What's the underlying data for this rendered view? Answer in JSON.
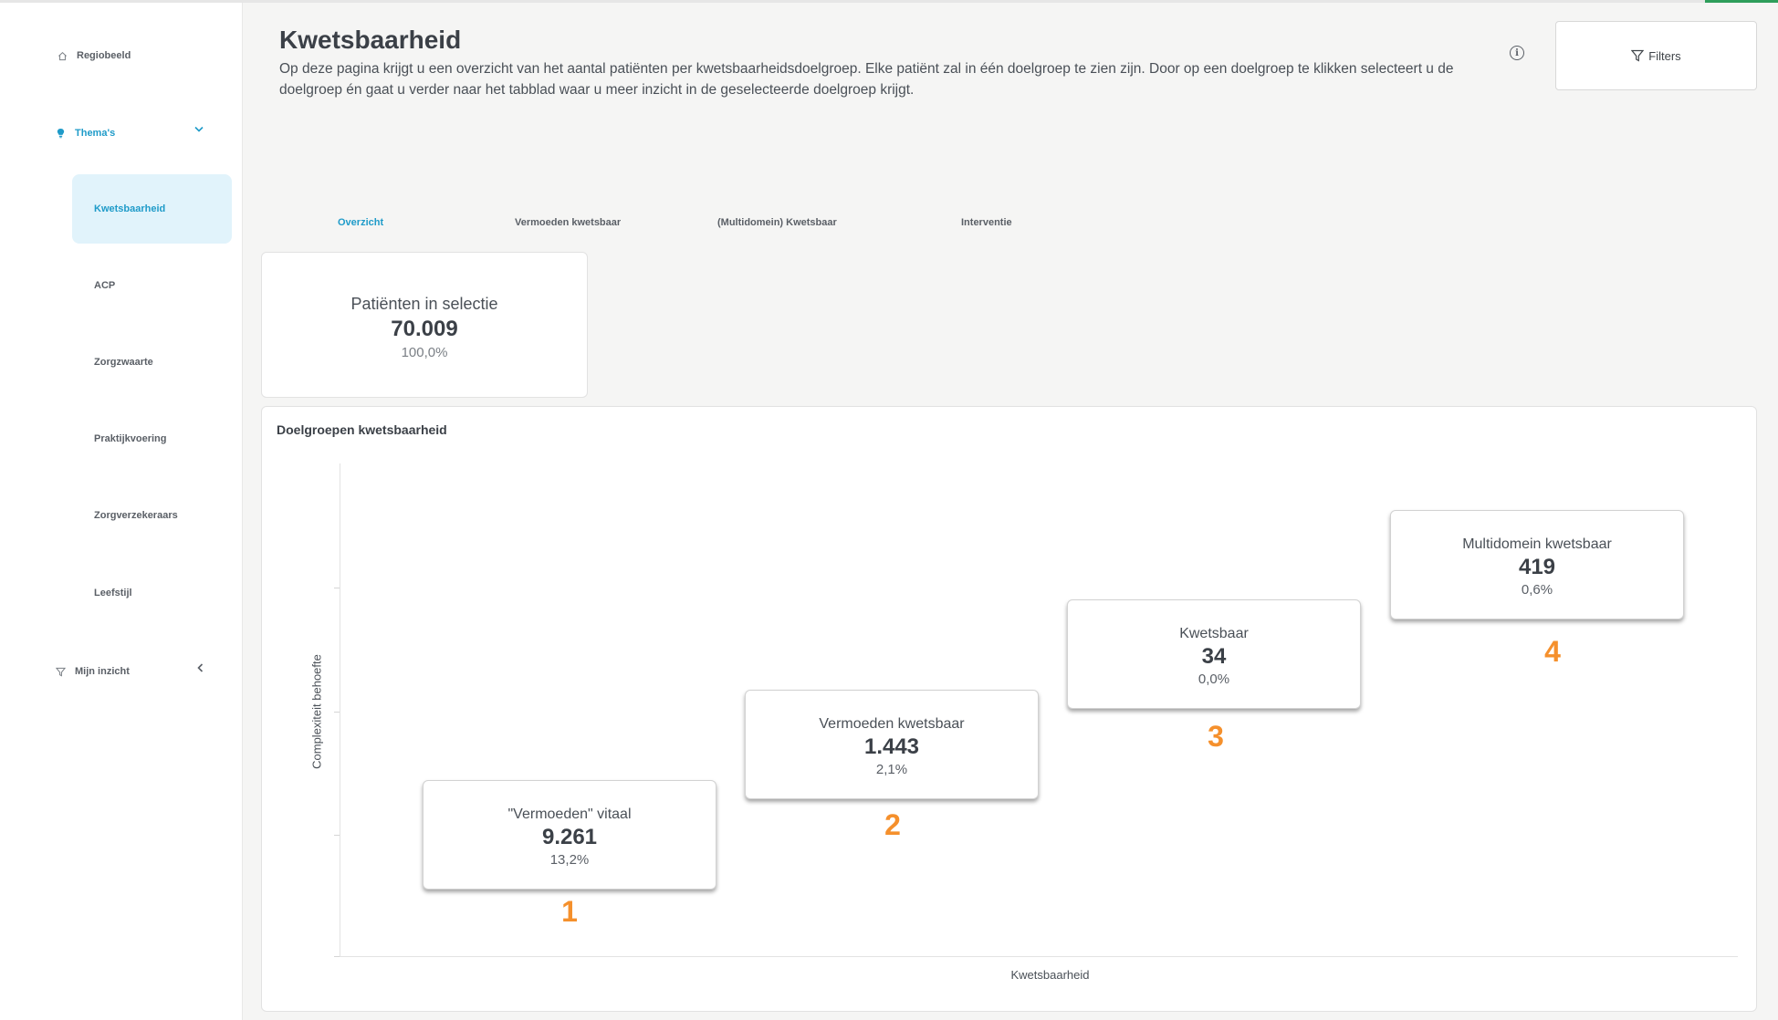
{
  "sidebar": {
    "items": [
      {
        "label": "Regiobeeld"
      },
      {
        "label": "Thema's"
      },
      {
        "label": "Mijn inzicht"
      }
    ],
    "sub_items": [
      {
        "label": "Kwetsbaarheid"
      },
      {
        "label": "ACP"
      },
      {
        "label": "Zorgzwaarte"
      },
      {
        "label": "Praktijkvoering"
      },
      {
        "label": "Zorgverzekeraars"
      },
      {
        "label": "Leefstijl"
      }
    ]
  },
  "header": {
    "title": "Kwetsbaarheid",
    "description": "Op deze pagina krijgt u een overzicht van het aantal patiënten per kwetsbaarheidsdoelgroep. Elke patiënt zal in één doelgroep te zien zijn. Door op een doelgroep te klikken selecteert u de doelgroep én gaat u verder naar het tabblad waar u meer inzicht in de geselecteerde doelgroep krijgt.",
    "filters_label": "Filters"
  },
  "tabs": [
    {
      "label": "Overzicht"
    },
    {
      "label": "Vermoeden kwetsbaar"
    },
    {
      "label": "(Multidomein) Kwetsbaar"
    },
    {
      "label": "Interventie"
    }
  ],
  "summary": {
    "label": "Patiënten in selectie",
    "value": "70.009",
    "percent": "100,0%"
  },
  "chart": {
    "title": "Doelgroepen kwetsbaarheid",
    "ylabel": "Complexiteit behoefte",
    "xlabel": "Kwetsbaarheid",
    "groups": [
      {
        "number": "1",
        "label": "\"Vermoeden\" vitaal",
        "value": "9.261",
        "percent": "13,2%"
      },
      {
        "number": "2",
        "label": "Vermoeden kwetsbaar",
        "value": "1.443",
        "percent": "2,1%"
      },
      {
        "number": "3",
        "label": "Kwetsbaar",
        "value": "34",
        "percent": "0,0%"
      },
      {
        "number": "4",
        "label": "Multidomein kwetsbaar",
        "value": "419",
        "percent": "0,6%"
      }
    ]
  },
  "colors": {
    "accent": "#1f9bc9",
    "active_bg": "#e1f3fb",
    "group_number": "#f5902c"
  }
}
